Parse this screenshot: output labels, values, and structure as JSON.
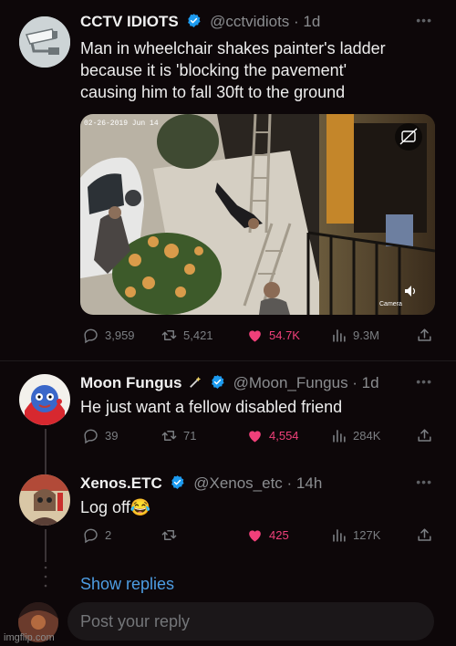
{
  "tweets": [
    {
      "name": "CCTV IDIOTS",
      "handle": "@cctvidiots · 1d",
      "text_lines": [
        "Man in wheelchair shakes painter's ladder",
        "because it is 'blocking the pavement'",
        "causing him to fall 30ft to the ground"
      ],
      "media_timestamp": "02-26-2019 Jun 14",
      "media_caption": "Camera",
      "stats": {
        "replies": "3,959",
        "retweets": "5,421",
        "likes": "54.7K",
        "views": "9.3M"
      }
    },
    {
      "name": "Moon Fungus",
      "handle": "@Moon_Fungus · 1d",
      "text": "He just want a fellow disabled friend",
      "stats": {
        "replies": "39",
        "retweets": "71",
        "likes": "4,554",
        "views": "284K"
      }
    },
    {
      "name": "Xenos.ETC",
      "handle": "@Xenos_etc · 14h",
      "text": "Log off😂",
      "stats": {
        "replies": "2",
        "retweets": "",
        "likes": "425",
        "views": "127K"
      }
    }
  ],
  "show_replies": "Show replies",
  "reply_placeholder": "Post your reply",
  "watermark": "imgflip.com",
  "colors": {
    "background": "#0d0709",
    "like": "#f0407a",
    "link": "#4d9de3",
    "verified": "#1d9bf0"
  },
  "icons": [
    "reply-icon",
    "retweet-icon",
    "heart-icon",
    "views-icon",
    "share-icon",
    "verified-badge-icon",
    "more-icon",
    "magic-wand-icon"
  ]
}
